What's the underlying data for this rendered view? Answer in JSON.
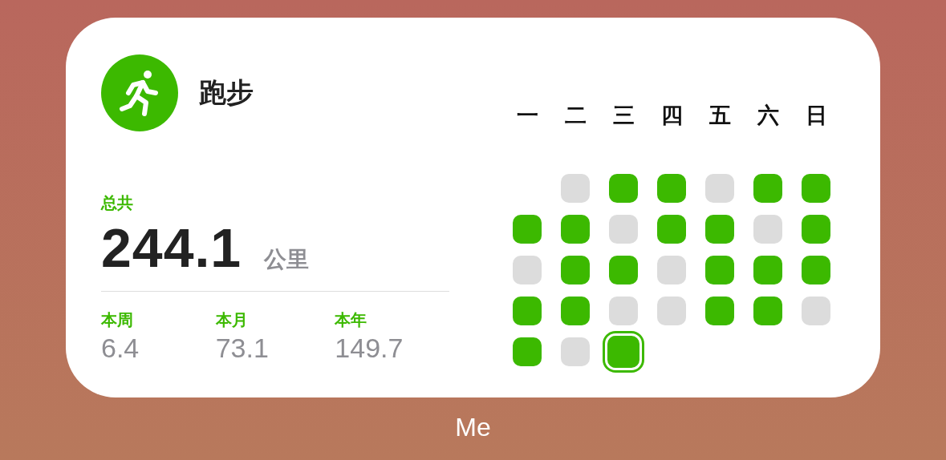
{
  "widget": {
    "title": "跑步",
    "total_label": "总共",
    "total_value": "244.1",
    "total_unit": "公里",
    "stats": [
      {
        "label": "本周",
        "value": "6.4"
      },
      {
        "label": "本月",
        "value": "73.1"
      },
      {
        "label": "本年",
        "value": "149.7"
      }
    ],
    "weekdays": [
      "一",
      "二",
      "三",
      "四",
      "五",
      "六",
      "日"
    ],
    "weeks": [
      {
        "cells": [
          {
            "kind": "blank"
          },
          {
            "kind": "day",
            "done": false,
            "today": false
          },
          {
            "kind": "day",
            "done": true,
            "today": false
          },
          {
            "kind": "day",
            "done": true,
            "today": false
          },
          {
            "kind": "day",
            "done": false,
            "today": false
          },
          {
            "kind": "day",
            "done": true,
            "today": false
          },
          {
            "kind": "day",
            "done": true,
            "today": false
          }
        ]
      },
      {
        "cells": [
          {
            "kind": "day",
            "done": true,
            "today": false
          },
          {
            "kind": "day",
            "done": true,
            "today": false
          },
          {
            "kind": "day",
            "done": false,
            "today": false
          },
          {
            "kind": "day",
            "done": true,
            "today": false
          },
          {
            "kind": "day",
            "done": true,
            "today": false
          },
          {
            "kind": "day",
            "done": false,
            "today": false
          },
          {
            "kind": "day",
            "done": true,
            "today": false
          }
        ]
      },
      {
        "cells": [
          {
            "kind": "day",
            "done": false,
            "today": false
          },
          {
            "kind": "day",
            "done": true,
            "today": false
          },
          {
            "kind": "day",
            "done": true,
            "today": false
          },
          {
            "kind": "day",
            "done": false,
            "today": false
          },
          {
            "kind": "day",
            "done": true,
            "today": false
          },
          {
            "kind": "day",
            "done": true,
            "today": false
          },
          {
            "kind": "day",
            "done": true,
            "today": false
          }
        ]
      },
      {
        "cells": [
          {
            "kind": "day",
            "done": true,
            "today": false
          },
          {
            "kind": "day",
            "done": true,
            "today": false
          },
          {
            "kind": "day",
            "done": false,
            "today": false
          },
          {
            "kind": "day",
            "done": false,
            "today": false
          },
          {
            "kind": "day",
            "done": true,
            "today": false
          },
          {
            "kind": "day",
            "done": true,
            "today": false
          },
          {
            "kind": "day",
            "done": false,
            "today": false
          }
        ]
      },
      {
        "cells": [
          {
            "kind": "day",
            "done": true,
            "today": false
          },
          {
            "kind": "day",
            "done": false,
            "today": false
          },
          {
            "kind": "day",
            "done": true,
            "today": true
          }
        ]
      }
    ]
  },
  "caption": "Me"
}
